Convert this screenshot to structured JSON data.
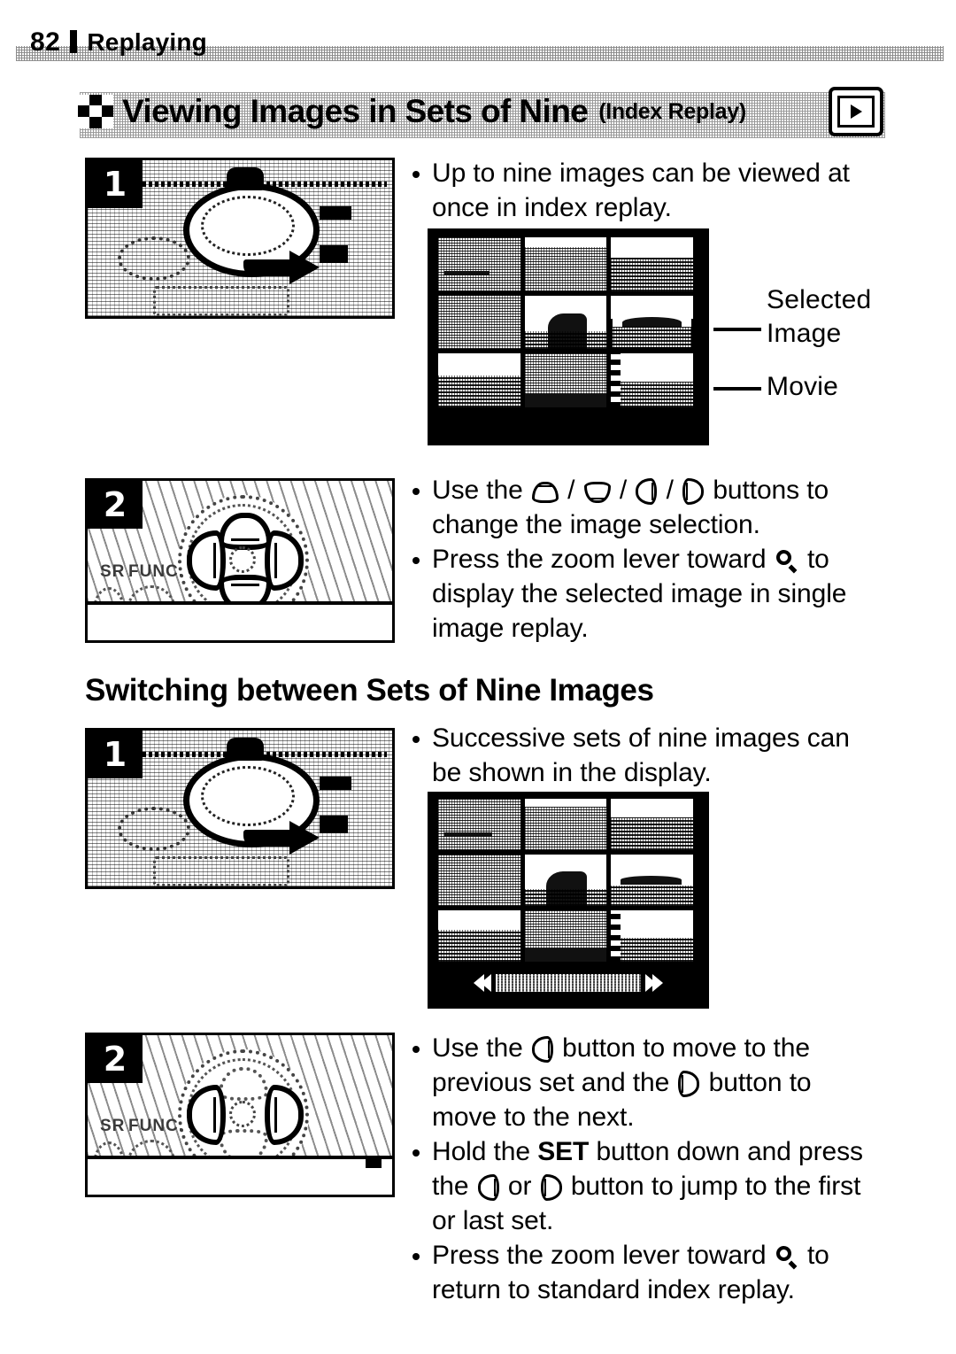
{
  "page": {
    "number": "82",
    "running_title": "Replaying"
  },
  "section": {
    "icon": "checkerboard-nine-icon",
    "title": "Viewing Images in Sets of Nine",
    "subtitle": "(Index Replay)",
    "mode_badge_icon": "playback-mode-icon"
  },
  "steps": {
    "step1_label": "1",
    "step2_label": "2",
    "step1b_label": "1",
    "step2b_label": "2",
    "illustration_1": "camera-mode-dial-rotate",
    "illustration_2": "camera-four-way-pad-all",
    "illustration_3": "camera-mode-dial-rotate",
    "illustration_4": "camera-four-way-pad-left-right"
  },
  "camera_art": {
    "func_label": "FUNC.",
    "sr_label": "SR"
  },
  "block1": {
    "bullets": [
      "Up to nine images can be viewed at once in index replay."
    ]
  },
  "callouts": {
    "selected_image": "Selected\nImage",
    "movie": "Movie"
  },
  "block2": {
    "bullet1_pre": "Use the ",
    "bullet1_sep": " / ",
    "bullet1_post": " buttons to change the image selection.",
    "bullet2_pre": "Press the zoom lever toward ",
    "bullet2_post": " to display the selected image in single image replay."
  },
  "sub_heading": "Switching between Sets of Nine Images",
  "block3": {
    "bullets": [
      "Successive sets of nine images can be shown in the display."
    ]
  },
  "block4": {
    "bullet1_a": "Use the ",
    "bullet1_b": " button to move to the previous set and the ",
    "bullet1_c": " button to move to the next.",
    "bullet2_a": "Hold the ",
    "bullet2_set": "SET",
    "bullet2_b": " button down and press the ",
    "bullet2_c": " or ",
    "bullet2_d": " button to jump to the first or last set.",
    "bullet3_a": "Press the zoom lever toward ",
    "bullet3_b": " to return to standard index replay."
  },
  "lcd1": {
    "name": "index-replay-screen",
    "selected_cell": 6,
    "movie_cell": 9,
    "cells": 9
  },
  "lcd2": {
    "name": "index-replay-screen-with-scrollbar",
    "cells": 9,
    "scrollbar_left_icon": "double-left-arrow-icon",
    "scrollbar_right_icon": "double-right-arrow-icon"
  },
  "colors": {
    "ink": "#000000",
    "paper": "#ffffff"
  }
}
